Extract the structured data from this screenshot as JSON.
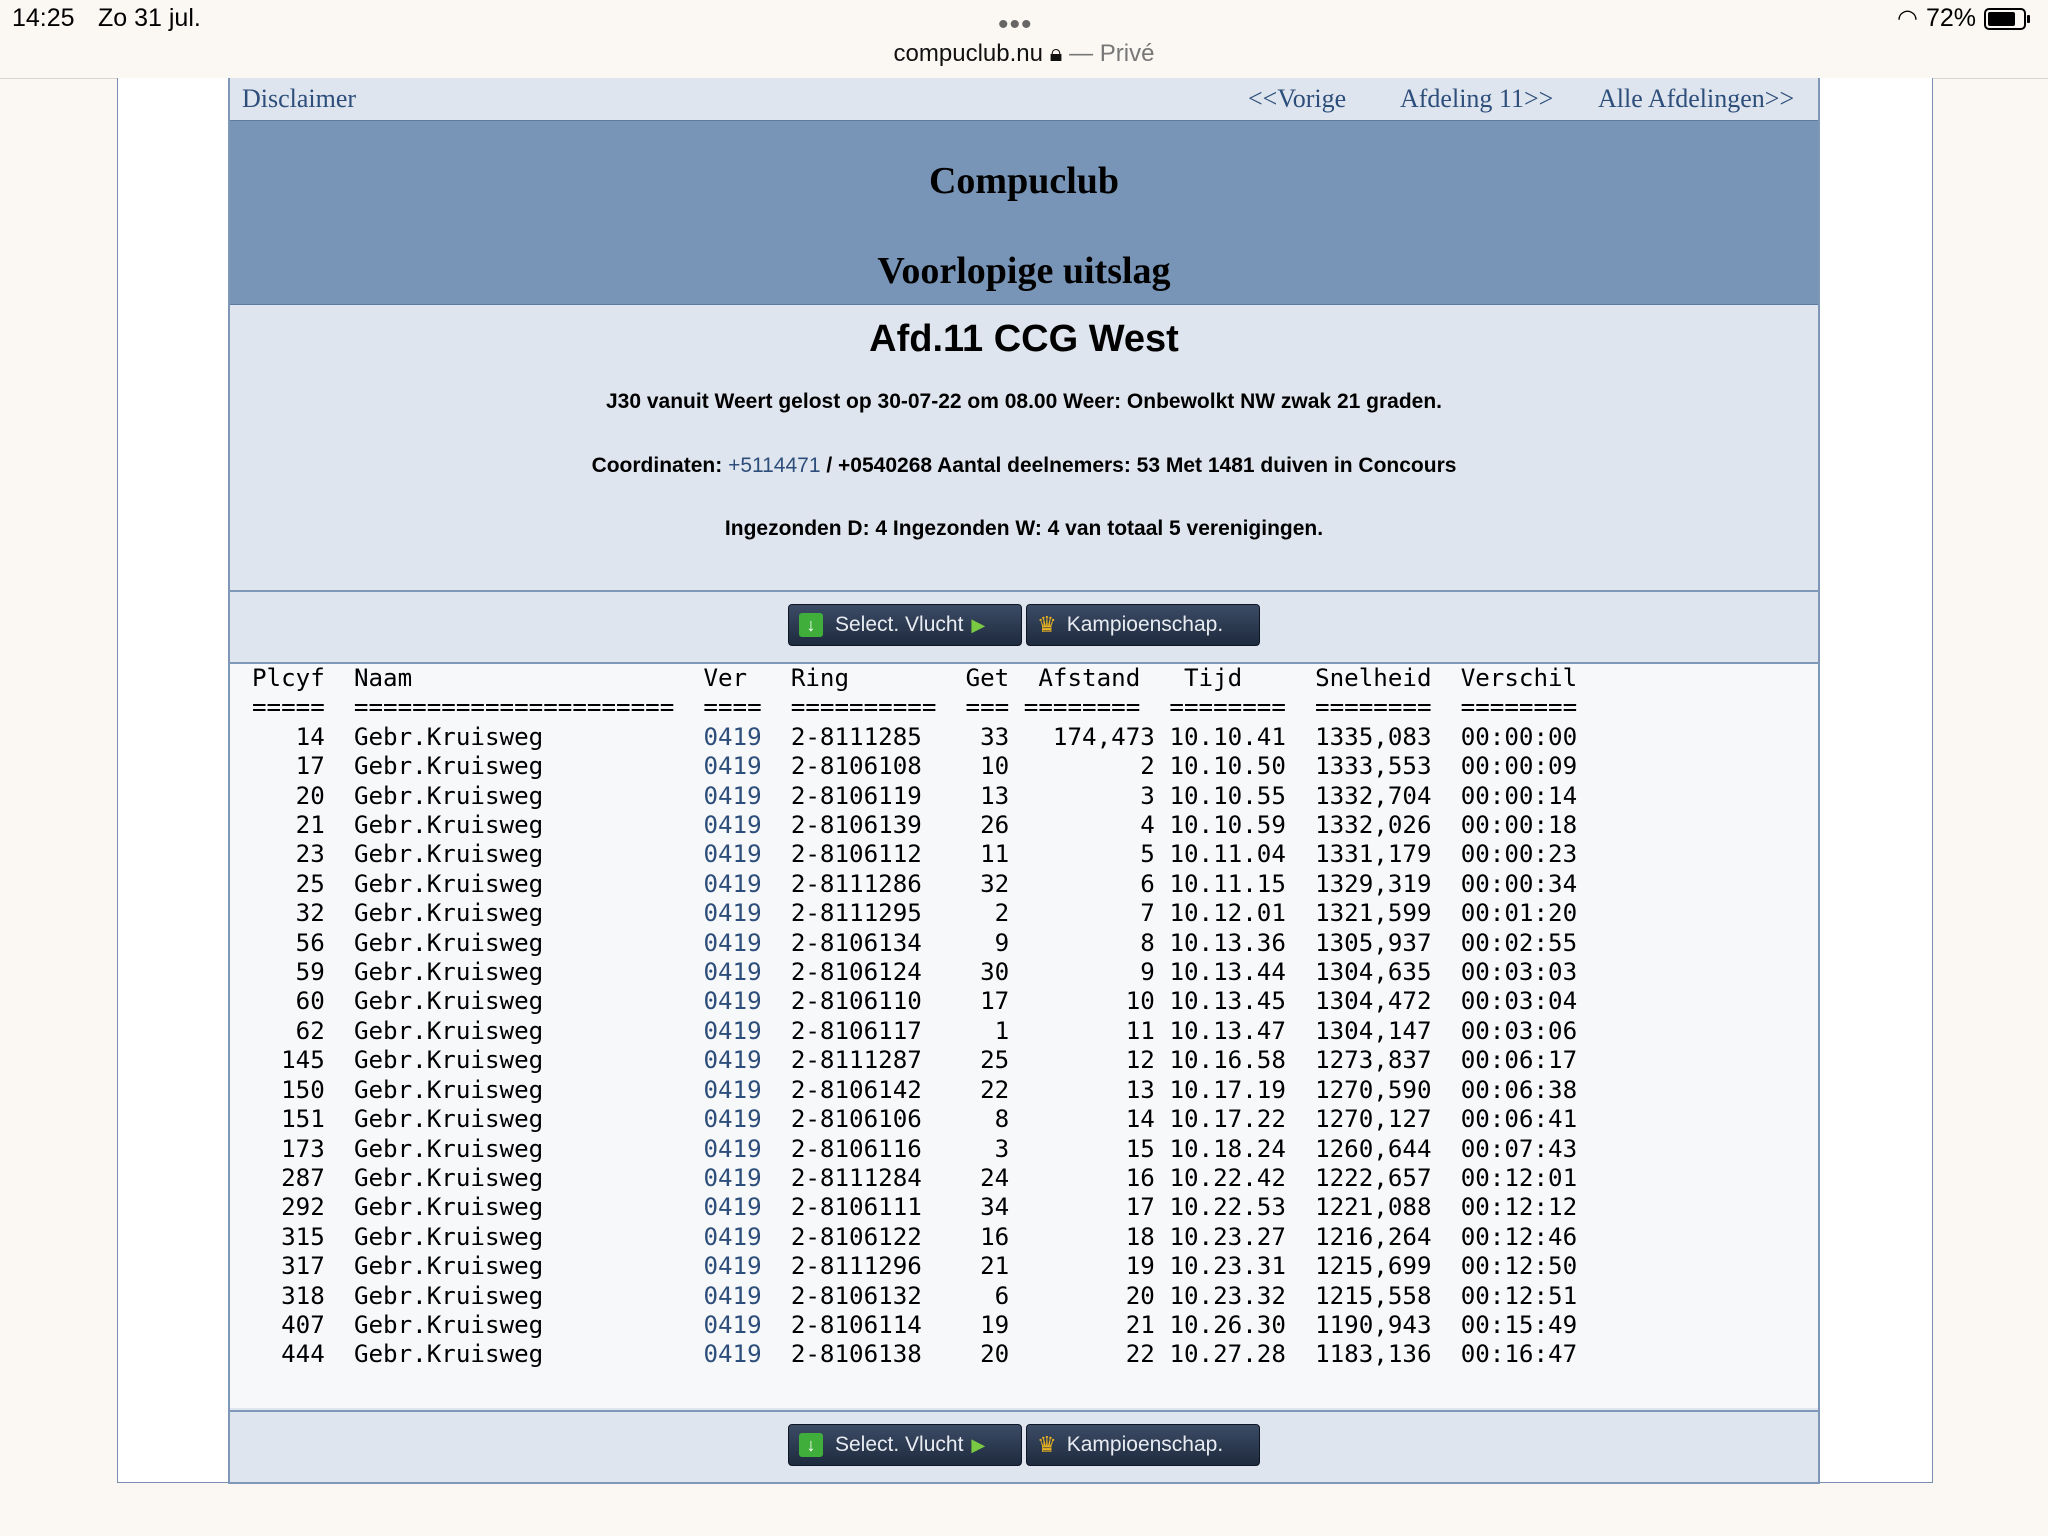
{
  "status_bar": {
    "time": "14:25",
    "date": "Zo 31 jul.",
    "url": "compuclub.nu",
    "private_label": "— Privé",
    "battery": "72%"
  },
  "nav": {
    "disclaimer": "Disclaimer",
    "previous": "<<Vorige",
    "next_section": "Afdeling 11>>",
    "all_sections": "Alle Afdelingen>>"
  },
  "banner": {
    "title": "Compuclub",
    "subtitle": "Voorlopige uitslag"
  },
  "info": {
    "heading": "Afd.11 CCG West",
    "line1": "J30 vanuit Weert gelost op 30-07-22 om 08.00 Weer: Onbewolkt NW zwak 21 graden.",
    "coord_label": "Coordinaten: ",
    "coord_link": "+5114471",
    "coord_rest": " / +0540268 Aantal deelnemers: 53 Met 1481 duiven in Concours",
    "line3": "Ingezonden D: 4 Ingezonden W: 4 van totaal 5 verenigingen."
  },
  "buttons": {
    "select_flight": "Select. Vlucht",
    "championship": "Kampioenschap."
  },
  "table": {
    "headers": [
      "Plcyf",
      "Naam",
      "Ver",
      "Ring",
      "Get",
      "Afstand",
      "Tijd",
      "Snelheid",
      "Verschil"
    ],
    "rows": [
      [
        "14",
        "Gebr.Kruisweg",
        "0419",
        "2-8111285",
        "33",
        "174,473",
        "10.10.41",
        "1335,083",
        "00:00:00"
      ],
      [
        "17",
        "Gebr.Kruisweg",
        "0419",
        "2-8106108",
        "10",
        "2",
        "10.10.50",
        "1333,553",
        "00:00:09"
      ],
      [
        "20",
        "Gebr.Kruisweg",
        "0419",
        "2-8106119",
        "13",
        "3",
        "10.10.55",
        "1332,704",
        "00:00:14"
      ],
      [
        "21",
        "Gebr.Kruisweg",
        "0419",
        "2-8106139",
        "26",
        "4",
        "10.10.59",
        "1332,026",
        "00:00:18"
      ],
      [
        "23",
        "Gebr.Kruisweg",
        "0419",
        "2-8106112",
        "11",
        "5",
        "10.11.04",
        "1331,179",
        "00:00:23"
      ],
      [
        "25",
        "Gebr.Kruisweg",
        "0419",
        "2-8111286",
        "32",
        "6",
        "10.11.15",
        "1329,319",
        "00:00:34"
      ],
      [
        "32",
        "Gebr.Kruisweg",
        "0419",
        "2-8111295",
        "2",
        "7",
        "10.12.01",
        "1321,599",
        "00:01:20"
      ],
      [
        "56",
        "Gebr.Kruisweg",
        "0419",
        "2-8106134",
        "9",
        "8",
        "10.13.36",
        "1305,937",
        "00:02:55"
      ],
      [
        "59",
        "Gebr.Kruisweg",
        "0419",
        "2-8106124",
        "30",
        "9",
        "10.13.44",
        "1304,635",
        "00:03:03"
      ],
      [
        "60",
        "Gebr.Kruisweg",
        "0419",
        "2-8106110",
        "17",
        "10",
        "10.13.45",
        "1304,472",
        "00:03:04"
      ],
      [
        "62",
        "Gebr.Kruisweg",
        "0419",
        "2-8106117",
        "1",
        "11",
        "10.13.47",
        "1304,147",
        "00:03:06"
      ],
      [
        "145",
        "Gebr.Kruisweg",
        "0419",
        "2-8111287",
        "25",
        "12",
        "10.16.58",
        "1273,837",
        "00:06:17"
      ],
      [
        "150",
        "Gebr.Kruisweg",
        "0419",
        "2-8106142",
        "22",
        "13",
        "10.17.19",
        "1270,590",
        "00:06:38"
      ],
      [
        "151",
        "Gebr.Kruisweg",
        "0419",
        "2-8106106",
        "8",
        "14",
        "10.17.22",
        "1270,127",
        "00:06:41"
      ],
      [
        "173",
        "Gebr.Kruisweg",
        "0419",
        "2-8106116",
        "3",
        "15",
        "10.18.24",
        "1260,644",
        "00:07:43"
      ],
      [
        "287",
        "Gebr.Kruisweg",
        "0419",
        "2-8111284",
        "24",
        "16",
        "10.22.42",
        "1222,657",
        "00:12:01"
      ],
      [
        "292",
        "Gebr.Kruisweg",
        "0419",
        "2-8106111",
        "34",
        "17",
        "10.22.53",
        "1221,088",
        "00:12:12"
      ],
      [
        "315",
        "Gebr.Kruisweg",
        "0419",
        "2-8106122",
        "16",
        "18",
        "10.23.27",
        "1216,264",
        "00:12:46"
      ],
      [
        "317",
        "Gebr.Kruisweg",
        "0419",
        "2-8111296",
        "21",
        "19",
        "10.23.31",
        "1215,699",
        "00:12:50"
      ],
      [
        "318",
        "Gebr.Kruisweg",
        "0419",
        "2-8106132",
        "6",
        "20",
        "10.23.32",
        "1215,558",
        "00:12:51"
      ],
      [
        "407",
        "Gebr.Kruisweg",
        "0419",
        "2-8106114",
        "19",
        "21",
        "10.26.30",
        "1190,943",
        "00:15:49"
      ],
      [
        "444",
        "Gebr.Kruisweg",
        "0419",
        "2-8106138",
        "20",
        "22",
        "10.27.28",
        "1183,136",
        "00:16:47"
      ]
    ]
  }
}
